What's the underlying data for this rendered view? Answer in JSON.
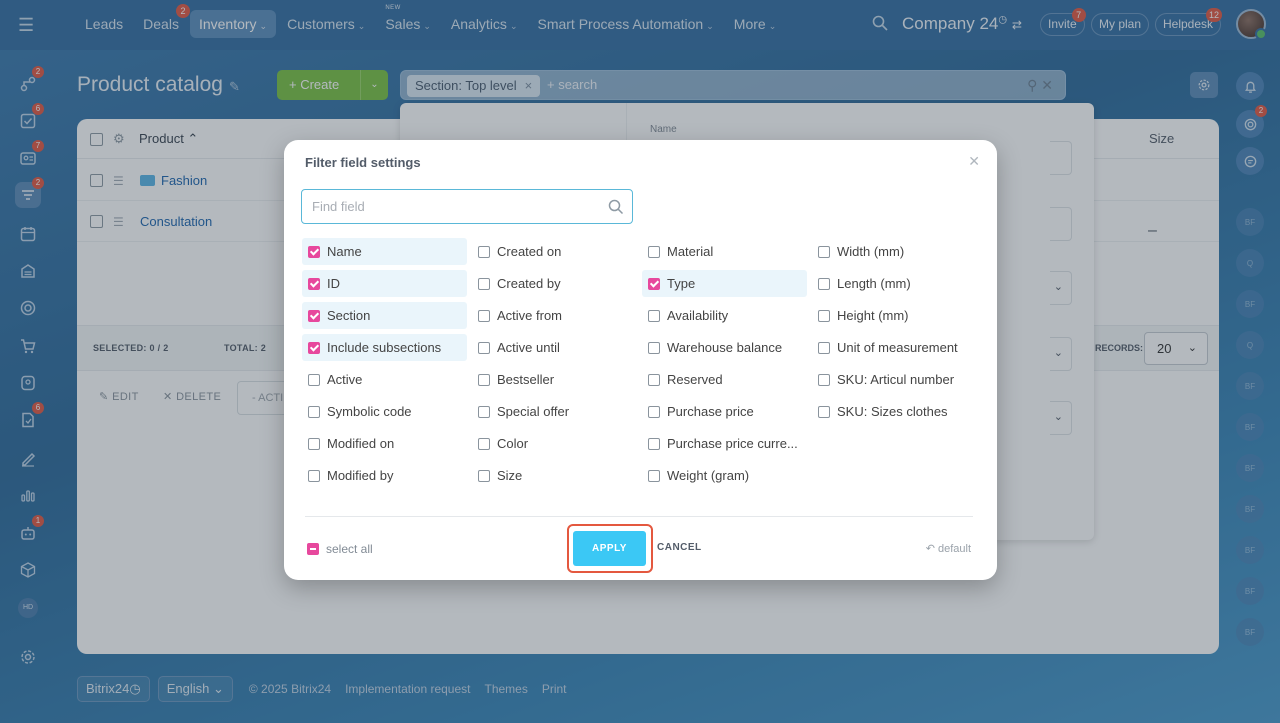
{
  "topbar": {
    "nav": [
      {
        "label": "Leads",
        "badge": "",
        "tag": "",
        "chevron": false,
        "active": false
      },
      {
        "label": "Deals",
        "badge": "2",
        "tag": "",
        "chevron": false,
        "active": false
      },
      {
        "label": "Inventory",
        "badge": "",
        "tag": "",
        "chevron": true,
        "active": true
      },
      {
        "label": "Customers",
        "badge": "",
        "tag": "",
        "chevron": true,
        "active": false
      },
      {
        "label": "Sales",
        "badge": "",
        "tag": "NEW",
        "chevron": true,
        "active": false
      },
      {
        "label": "Analytics",
        "badge": "",
        "tag": "",
        "chevron": true,
        "active": false
      },
      {
        "label": "Smart Process Automation",
        "badge": "",
        "tag": "",
        "chevron": true,
        "active": false
      },
      {
        "label": "More",
        "badge": "",
        "tag": "",
        "chevron": true,
        "active": false
      }
    ],
    "company": "Company 24",
    "invite": "Invite",
    "invite_badge": "7",
    "my_plan": "My plan",
    "helpdesk": "Helpdesk",
    "helpdesk_badge": "12"
  },
  "sidebar": {
    "badges": [
      "2",
      "6",
      "7",
      "2",
      "6",
      "1"
    ],
    "hd": "HD"
  },
  "rightbar": {
    "badge": "2",
    "avatars": [
      "BF",
      "Q",
      "BF",
      "Q",
      "BF",
      "BF",
      "BF",
      "BF",
      "BF",
      "BF",
      "BF"
    ]
  },
  "page": {
    "title": "Product catalog",
    "create_label": "Create",
    "filter_chip": "Section: Top level",
    "search_placeholder": "+ search"
  },
  "grid": {
    "header_product": "Product",
    "header_size": "Size",
    "rows": [
      {
        "name": "Fashion",
        "size": ""
      },
      {
        "name": "Consultation",
        "size": "–"
      }
    ],
    "selected": "SELECTED: 0 / 2",
    "total": "TOTAL: 2",
    "records_label": "RECORDS:",
    "records_value": "20",
    "edit": "EDIT",
    "delete": "DELETE",
    "action_select": "- ACTI"
  },
  "filter_popup": {
    "name_label": "Name"
  },
  "footer": {
    "brand": "Bitrix24",
    "language": "English",
    "copyright": "© 2025 Bitrix24",
    "impl": "Implementation request",
    "themes": "Themes",
    "print": "Print"
  },
  "modal": {
    "title": "Filter field settings",
    "find_placeholder": "Find field",
    "columns": [
      [
        {
          "label": "Name",
          "checked": true
        },
        {
          "label": "ID",
          "checked": true
        },
        {
          "label": "Section",
          "checked": true
        },
        {
          "label": "Include subsections",
          "checked": true
        },
        {
          "label": "Active",
          "checked": false
        },
        {
          "label": "Symbolic code",
          "checked": false
        },
        {
          "label": "Modified on",
          "checked": false
        },
        {
          "label": "Modified by",
          "checked": false
        }
      ],
      [
        {
          "label": "Created on",
          "checked": false
        },
        {
          "label": "Created by",
          "checked": false
        },
        {
          "label": "Active from",
          "checked": false
        },
        {
          "label": "Active until",
          "checked": false
        },
        {
          "label": "Bestseller",
          "checked": false
        },
        {
          "label": "Special offer",
          "checked": false
        },
        {
          "label": "Color",
          "checked": false
        },
        {
          "label": "Size",
          "checked": false
        }
      ],
      [
        {
          "label": "Material",
          "checked": false
        },
        {
          "label": "Type",
          "checked": true
        },
        {
          "label": "Availability",
          "checked": false
        },
        {
          "label": "Warehouse balance",
          "checked": false
        },
        {
          "label": "Reserved",
          "checked": false
        },
        {
          "label": "Purchase price",
          "checked": false
        },
        {
          "label": "Purchase price curre...",
          "checked": false
        },
        {
          "label": "Weight (gram)",
          "checked": false
        }
      ],
      [
        {
          "label": "Width (mm)",
          "checked": false
        },
        {
          "label": "Length (mm)",
          "checked": false
        },
        {
          "label": "Height (mm)",
          "checked": false
        },
        {
          "label": "Unit of measurement",
          "checked": false
        },
        {
          "label": "SKU: Articul number",
          "checked": false
        },
        {
          "label": "SKU: Sizes clothes",
          "checked": false
        }
      ]
    ],
    "select_all": "select all",
    "apply": "APPLY",
    "cancel": "CANCEL",
    "default": "default"
  },
  "colors": {
    "accent": "#3bc8f5",
    "checked": "#e7489d",
    "highlight": "#e4583f"
  }
}
